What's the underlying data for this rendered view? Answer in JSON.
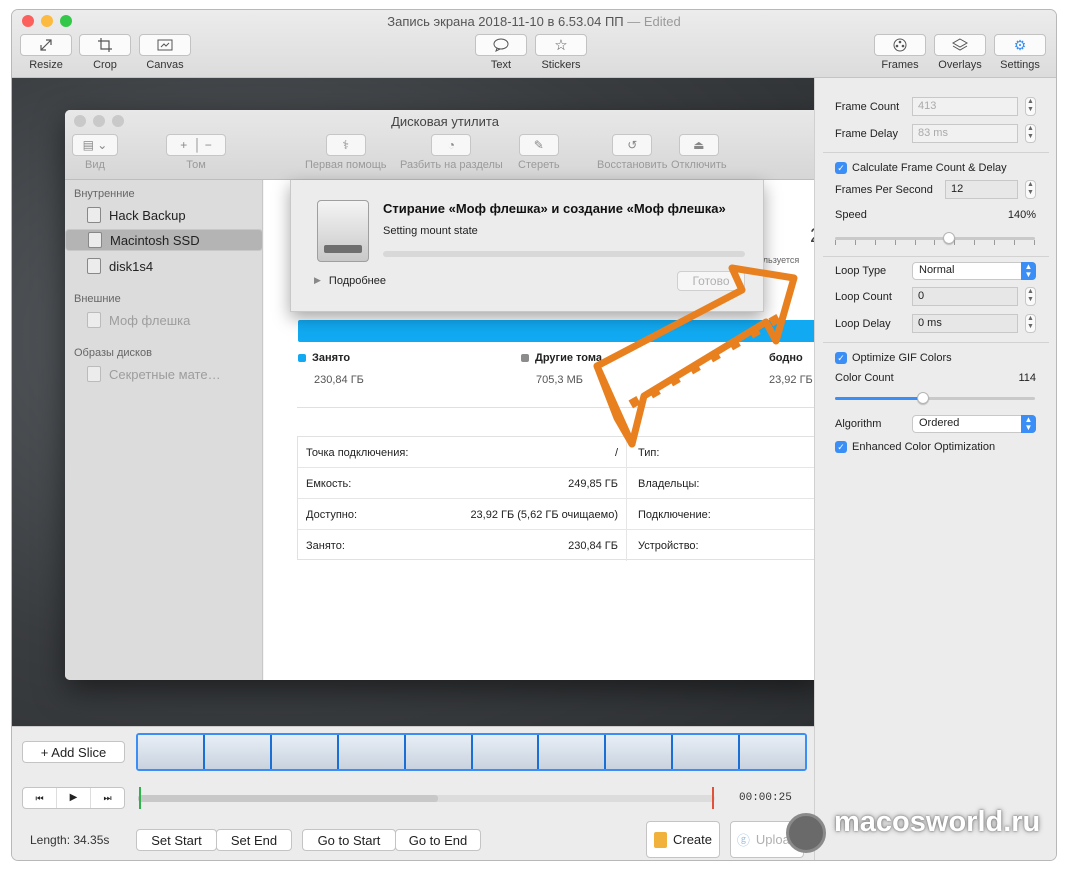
{
  "window": {
    "title": "Запись экрана 2018-11-10 в 6.53.04 ПП",
    "edited": "— Edited"
  },
  "toolbar": {
    "resize": "Resize",
    "crop": "Crop",
    "canvas": "Canvas",
    "text": "Text",
    "stickers": "Stickers",
    "frames": "Frames",
    "overlays": "Overlays",
    "settings": "Settings"
  },
  "settings_panel": {
    "frame_count_label": "Frame Count",
    "frame_count_value": "413",
    "frame_delay_label": "Frame Delay",
    "frame_delay_value": "83 ms",
    "calc_checkbox": "Calculate Frame Count & Delay",
    "fps_label": "Frames Per Second",
    "fps_value": "12",
    "speed_label": "Speed",
    "speed_value": "140%",
    "loop_type_label": "Loop Type",
    "loop_type_value": "Normal",
    "loop_count_label": "Loop Count",
    "loop_count_value": "0",
    "loop_delay_label": "Loop Delay",
    "loop_delay_value": "0 ms",
    "optimize_checkbox": "Optimize GIF Colors",
    "color_count_label": "Color Count",
    "color_count_value": "114",
    "algorithm_label": "Algorithm",
    "algorithm_value": "Ordered",
    "enhanced_checkbox": "Enhanced Color Optimization",
    "speed_fraction": 0.57,
    "color_fraction": 0.44
  },
  "bottom": {
    "add_slice": "+ Add Slice",
    "time": "00:00:25",
    "length": "Length: 34.35s",
    "set_start": "Set Start",
    "set_end": "Set End",
    "go_start": "Go to Start",
    "go_end": "Go to End",
    "create": "Create",
    "upload": "Upload",
    "watermark": "macosworld.ru"
  },
  "disk_utility": {
    "title": "Дисковая утилита",
    "toolbar": {
      "view": "Вид",
      "volume": "Том",
      "first_aid": "Первая помощь",
      "partition": "Разбить на разделы",
      "erase": "Стереть",
      "restore": "Восстановить",
      "unmount": "Отключить"
    },
    "sidebar": {
      "internal": "Внутренние",
      "items_internal": [
        "Hack Backup",
        "Macintosh SSD",
        "disk1s4"
      ],
      "external": "Внешние",
      "items_external": [
        "Моф флешка"
      ],
      "images": "Образы дисков",
      "items_images": [
        "Секретные мате…"
      ]
    },
    "sheet": {
      "title": "Стирание «Моф флешка» и создание «Моф флешка»",
      "status": "Setting mount state",
      "details": "Подробнее",
      "done": "Готово"
    },
    "usage": {
      "used_label": "Занято",
      "used_value": "230,84 ГБ",
      "other_label": "Другие тома",
      "other_value": "705,3 МБ",
      "free_partial": "бодно",
      "free_value": "23,92 ГБ",
      "partial_right": "ользуется",
      "partial_digit": "2"
    },
    "info_left": [
      {
        "k": "Точка подключения:",
        "v": "/"
      },
      {
        "k": "Емкость:",
        "v": "249,85 ГБ"
      },
      {
        "k": "Доступно:",
        "v": "23,92 ГБ (5,62 ГБ очищаемо)"
      },
      {
        "k": "Занято:",
        "v": "230,84 ГБ"
      }
    ],
    "info_right": [
      "Тип:",
      "Владельцы:",
      "Подключение:",
      "Устройство:"
    ]
  },
  "colors": {
    "accent": "#3a8ef6",
    "arrow": "#e8801f",
    "usage_bar": "#11aaf2"
  }
}
